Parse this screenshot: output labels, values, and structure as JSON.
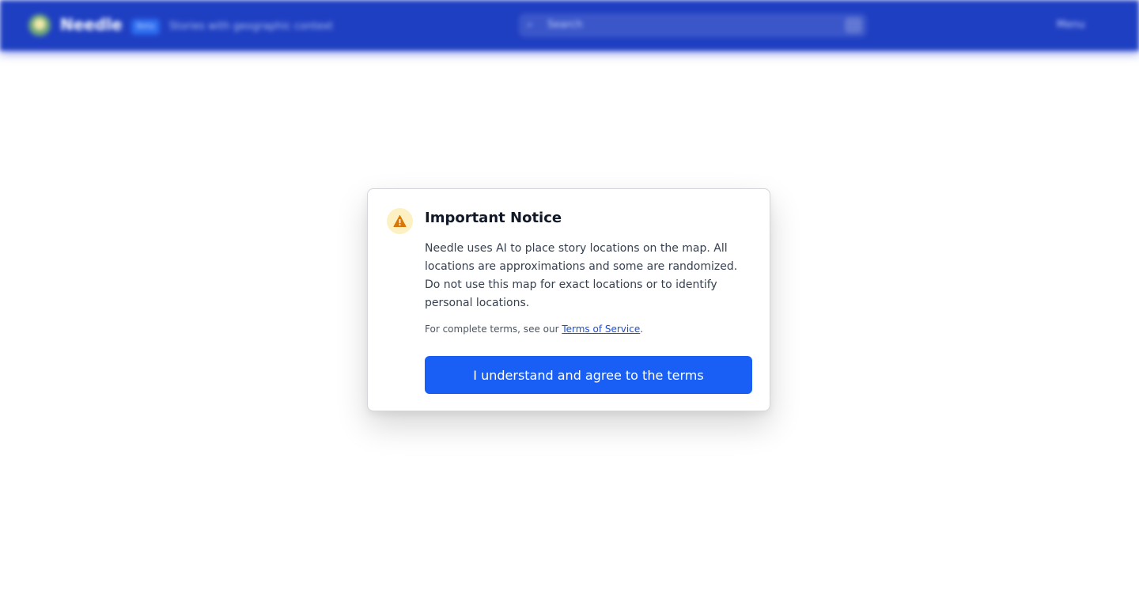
{
  "header": {
    "brand": "Needle",
    "badge": "Beta",
    "tagline": "Stories with geographic context",
    "search_placeholder": "Search",
    "menu_label": "Menu"
  },
  "modal": {
    "title": "Important Notice",
    "icon": "warning-icon",
    "body": "Needle uses AI to place story locations on the map. All locations are approximations and some are randomized. Do not use this map for exact locations or to identify personal locations.",
    "terms_prefix": "For complete terms, see our ",
    "terms_link": "Terms of Service",
    "terms_suffix": ".",
    "agree_button": "I understand and agree to the terms"
  },
  "colors": {
    "header_bg": "#1f3fc2",
    "primary_button": "#1a5ff5",
    "warning_icon": "#d97706",
    "warning_bg": "#fdf1c4",
    "link": "#1d4ed8"
  }
}
